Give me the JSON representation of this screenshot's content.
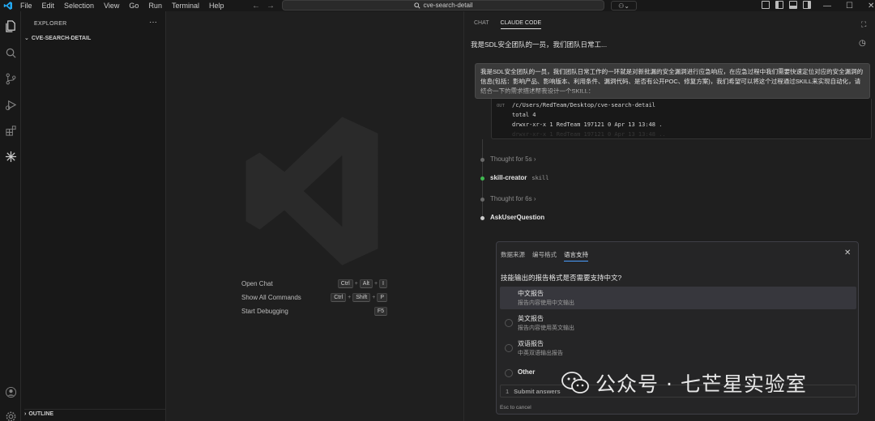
{
  "titlebar": {
    "menu": [
      "File",
      "Edit",
      "Selection",
      "View",
      "Go",
      "Run",
      "Terminal",
      "Help"
    ],
    "search_text": "cve-search-detail"
  },
  "sidebar": {
    "title": "EXPLORER",
    "more": "···",
    "folder": "CVE-SEARCH-DETAIL",
    "outline": "OUTLINE"
  },
  "editor": {
    "shortcuts": [
      {
        "label": "Open Chat",
        "keys": [
          "Ctrl",
          "Alt",
          "I"
        ]
      },
      {
        "label": "Show All Commands",
        "keys": [
          "Ctrl",
          "Shift",
          "P"
        ]
      },
      {
        "label": "Start Debugging",
        "keys": [
          "F5"
        ]
      }
    ]
  },
  "chat": {
    "tabs": [
      "CHAT",
      "CLAUDE CODE"
    ],
    "active_tab": 1,
    "session_title": "我是SDL安全团队的一员，我们团队日常工...",
    "user_message": "我是SDL安全团队的一员，我们团队日常工作的一环就是对新批漏的安全漏洞进行应急响应，在应急过程中我们需要快速定位对应的安全漏洞的信息(包括：影响产品、影响版本、利用条件、漏洞代码、是否有公开POC、修复方案)，我们希望可以将这个过程通过SKILL来实现自动化，请结合一下的需求描述帮我设计一个SKILL：",
    "code": {
      "label": "OUT",
      "lines": [
        "/c/Users/RedTeam/Desktop/cve-search-detail",
        "total 4",
        "drwxr-xr-x 1 RedTeam 197121 0 Apr 13 13:48 .",
        "drwxr-xr-x 1 RedTeam 197121 0 Apr 13 13:48 .."
      ]
    },
    "steps": {
      "thought1": "Thought for 5s",
      "skill_name": "skill-creator",
      "skill_tag": "skill",
      "thought2": "Thought for 6s",
      "ask": "AskUserQuestion"
    },
    "question": {
      "tabs": [
        "数据来源",
        "编号格式",
        "语言支持"
      ],
      "active_tab": 2,
      "text": "技能输出的报告格式是否需要支持中文?",
      "options": [
        {
          "title": "中文报告",
          "desc": "报告内容使用中文输出"
        },
        {
          "title": "英文报告",
          "desc": "报告内容使用英文输出"
        },
        {
          "title": "双语报告",
          "desc": "中英双语输出报告"
        },
        {
          "title": "Other",
          "desc": ""
        }
      ],
      "submit_num": "1",
      "submit_label": "Submit answers",
      "esc_hint": "Esc to cancel"
    }
  },
  "watermark": {
    "text": "公众号 · 七芒星实验室"
  },
  "colors": {
    "accent_blue": "#4a9eff",
    "vscode_blue": "#23a9f2",
    "green_dot": "#3fb950"
  }
}
